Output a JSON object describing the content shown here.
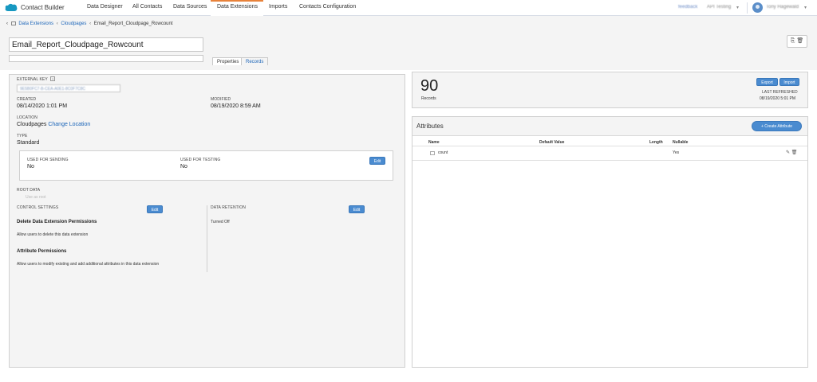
{
  "app": {
    "title": "Contact Builder"
  },
  "nav": {
    "items": [
      "Data Designer",
      "All Contacts",
      "Data Sources",
      "Data Extensions",
      "Imports",
      "Contacts Configuration"
    ],
    "active": "Data Extensions",
    "feedback": "feedback",
    "account": "API Testing",
    "user": "Tony Hagewald"
  },
  "breadcrumb": {
    "items": [
      "Data Extensions",
      "Cloudpages",
      "Email_Report_Cloudpage_Rowcount"
    ]
  },
  "de": {
    "name": "Email_Report_Cloudpage_Rowcount",
    "description": ""
  },
  "tabs": {
    "properties": "Properties",
    "records": "Records"
  },
  "properties": {
    "external_key_label": "EXTERNAL KEY",
    "external_key_value": "9E5B0FC7-B-CEA-A0E1-8C0F7C8C",
    "created_label": "CREATED",
    "created_value": "08/14/2020 1:01 PM",
    "modified_label": "MODIFIED",
    "modified_value": "08/19/2020 8:59 AM",
    "location_label": "LOCATION",
    "location_value": "Cloudpages",
    "change_location": "Change Location",
    "type_label": "TYPE",
    "type_value": "Standard",
    "used_for_sending_label": "USED FOR SENDING",
    "used_for_sending_value": "No",
    "used_for_testing_label": "USED FOR TESTING",
    "used_for_testing_value": "No",
    "edit_label": "Edit",
    "root_data_label": "ROOT DATA",
    "root_data_value": "Use as root",
    "control_settings_label": "CONTROL SETTINGS",
    "data_retention_label": "DATA RETENTION",
    "data_retention_value": "Turned Off",
    "delete_perm_title": "Delete Data Extension Permissions",
    "delete_perm_desc": "Allow users to delete this data extension",
    "attr_perm_title": "Attribute Permissions",
    "attr_perm_desc": "Allow users to modify existing and add additional attributes in this data extension"
  },
  "records": {
    "count": "90",
    "label": "Records",
    "export": "Export",
    "import": "Import",
    "last_refreshed_label": "LAST REFRESHED",
    "last_refreshed_value": "08/19/2020 5:01 PM"
  },
  "attributes": {
    "title": "Attributes",
    "create_button": "+ Create Attribute",
    "columns": [
      "Name",
      "Default Value",
      "Length",
      "Nullable"
    ],
    "rows": [
      {
        "name": "count",
        "default_value": "",
        "length": "",
        "nullable": "Yes"
      }
    ]
  },
  "colors": {
    "accent": "#4a8bd0",
    "active_tab": "#e8823a",
    "link": "#1a64b8"
  }
}
